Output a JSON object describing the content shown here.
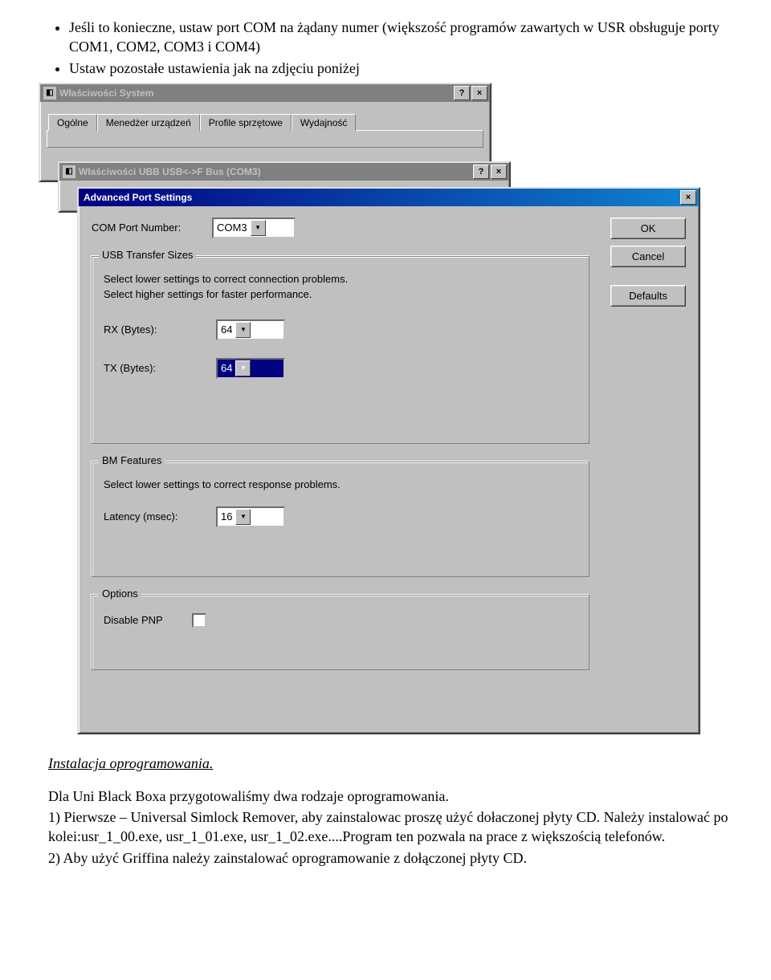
{
  "bullets": [
    "Jeśli to konieczne, ustaw port COM na żądany numer (większość programów zawartych w USR obsługuje porty COM1, COM2, COM3 i COM4)",
    "Ustaw pozostałe ustawienia jak na zdjęciu poniżej"
  ],
  "win_system": {
    "title": "Właściwości System",
    "tabs": [
      "Ogólne",
      "Menedżer urządzeń",
      "Profile sprzętowe",
      "Wydajność"
    ],
    "active_tab": "Menedżer urządzeń"
  },
  "win_port": {
    "title": "Właściwości UBB USB<->F Bus (COM3)"
  },
  "win_advanced": {
    "title": "Advanced Port Settings",
    "com_label": "COM Port Number:",
    "com_value": "COM3",
    "buttons": {
      "ok": "OK",
      "cancel": "Cancel",
      "defaults": "Defaults"
    },
    "group_usb": {
      "legend": "USB Transfer Sizes",
      "help1": "Select lower settings to correct connection problems.",
      "help2": "Select higher settings for faster performance.",
      "rx_label": "RX (Bytes):",
      "rx_value": "64",
      "tx_label": "TX (Bytes):",
      "tx_value": "64"
    },
    "group_bm": {
      "legend": "BM Features",
      "help1": "Select lower settings to correct response problems.",
      "lat_label": "Latency (msec):",
      "lat_value": "16"
    },
    "group_opt": {
      "legend": "Options",
      "pnp_label": "Disable PNP"
    }
  },
  "instal_heading": "Instalacja oprogramowania.",
  "para1": "Dla Uni Black Boxa  przygotowaliśmy dwa rodzaje oprogramowania.",
  "para2": "1) Pierwsze –  Universal Simlock Remover, aby zainstalowac proszę użyć dołaczonej płyty CD. Należy instalować po kolei:usr_1_00.exe, usr_1_01.exe, usr_1_02.exe....Program ten pozwala na prace z większością telefonów.",
  "para3": "2) Aby użyć Griffina należy zainstalować oprogramowanie z dołączonej płyty CD."
}
